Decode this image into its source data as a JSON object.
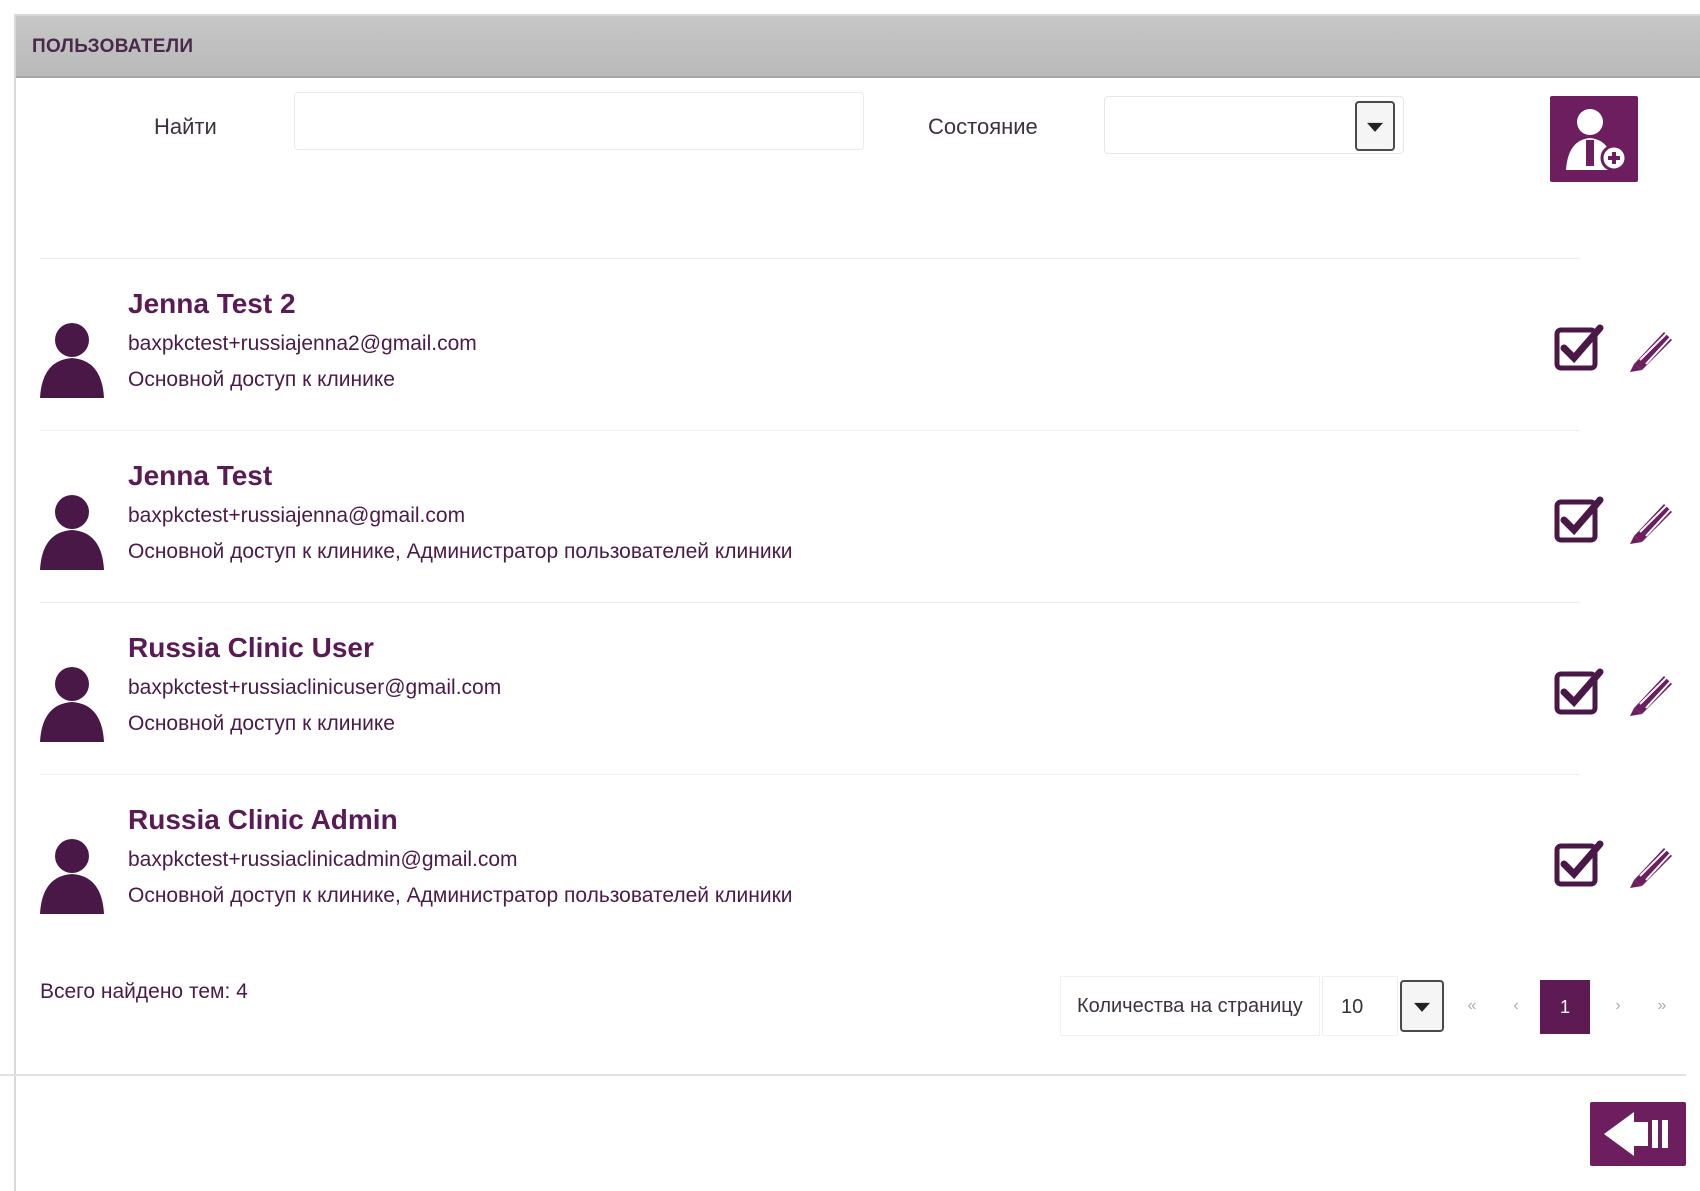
{
  "header": {
    "title": "ПОЛЬЗОВАТЕЛИ"
  },
  "filters": {
    "search_label": "Найти",
    "search_value": "",
    "search_placeholder": "",
    "status_label": "Состояние",
    "status_value": ""
  },
  "users": [
    {
      "name": "Jenna Test 2",
      "email": "baxpkctest+russiajenna2@gmail.com",
      "roles": "Основной доступ к клинике"
    },
    {
      "name": "Jenna Test",
      "email": "baxpkctest+russiajenna@gmail.com",
      "roles": "Основной доступ к клинике, Администратор пользователей клиники"
    },
    {
      "name": "Russia Clinic User",
      "email": "baxpkctest+russiaclinicuser@gmail.com",
      "roles": "Основной доступ к клинике"
    },
    {
      "name": "Russia Clinic Admin",
      "email": "baxpkctest+russiaclinicadmin@gmail.com",
      "roles": "Основной доступ к клинике, Администратор пользователей клиники"
    }
  ],
  "footer": {
    "total_text": "Всего найдено тем: 4",
    "per_page_label": "Количества на страницу",
    "per_page_value": "10",
    "first_symbol": "«",
    "prev_symbol": "‹",
    "current_page": "1",
    "next_symbol": "›",
    "last_symbol": "»"
  },
  "colors": {
    "accent": "#6c1e5e",
    "text": "#4a1a48",
    "header_bg": "#c0c0c0"
  }
}
